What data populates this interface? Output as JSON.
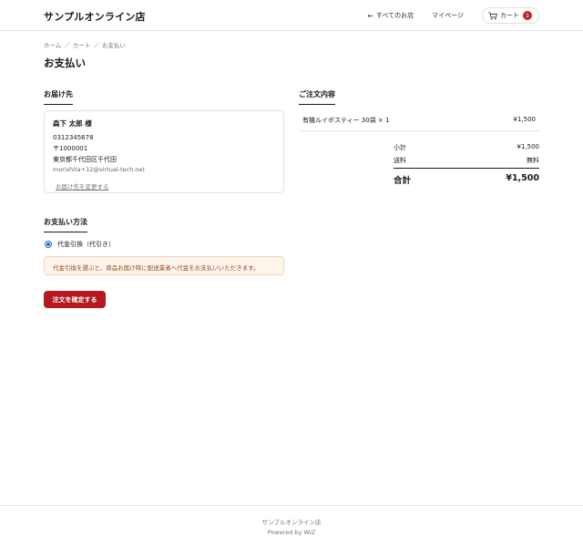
{
  "header": {
    "brand": "サンプルオンライン店",
    "nav_all_shops": "すべてのお店",
    "nav_mypage": "マイページ",
    "cart_label": "カート",
    "cart_count": "1"
  },
  "breadcrumb": [
    "ホーム",
    "カート",
    "お支払い"
  ],
  "page_title": "お支払い",
  "shipping": {
    "heading": "お届け先",
    "name": "森下 太郎 様",
    "phone": "0312345678",
    "postal": "〒1000001",
    "address": "東京都千代田区千代田",
    "email": "morishita+12@virtual-tech.net",
    "change_link": "お届け先を変更する"
  },
  "payment": {
    "heading": "お支払い方法",
    "option_label": "代金引換（代引き）",
    "notice": "代金引換を選ぶと、商品お届け時に配送業者へ代金をお支払いいただきます。"
  },
  "confirm_label": "注文を確定する",
  "order": {
    "heading": "ご注文内容",
    "items": [
      {
        "name": "有機ルイボスティー 30袋 × 1",
        "price": "¥1,500"
      }
    ],
    "subtotal_label": "小計",
    "subtotal": "¥1,500",
    "shipping_label": "送料",
    "shipping_fee": "無料",
    "total_label": "合計",
    "total": "¥1,500"
  },
  "footer": {
    "shop": "サンプルオンライン店",
    "powered": "Powered by WIZ"
  },
  "colors": {
    "accent": "#b5191f",
    "badge": "#c0262d",
    "radio": "#1a6fd6",
    "notice_bg": "#fdf5ec"
  }
}
